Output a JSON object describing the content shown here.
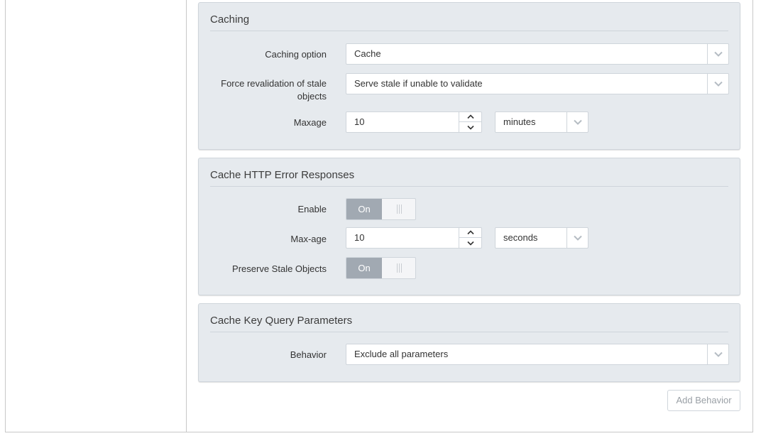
{
  "caching": {
    "title": "Caching",
    "option_label": "Caching option",
    "option_value": "Cache",
    "revalidation_label": "Force revalidation of stale objects",
    "revalidation_value": "Serve stale if unable to validate",
    "maxage_label": "Maxage",
    "maxage_value": "10",
    "maxage_unit": "minutes"
  },
  "error_responses": {
    "title": "Cache HTTP Error Responses",
    "enable_label": "Enable",
    "enable_state": "On",
    "maxage_label": "Max-age",
    "maxage_value": "10",
    "maxage_unit": "seconds",
    "preserve_label": "Preserve Stale Objects",
    "preserve_state": "On"
  },
  "cache_key": {
    "title": "Cache Key Query Parameters",
    "behavior_label": "Behavior",
    "behavior_value": "Exclude all parameters"
  },
  "actions": {
    "add_behavior_label": "Add Behavior"
  },
  "colors": {
    "panel_bg": "#e6eaee",
    "toggle_on": "#a1a9b2",
    "caret": "#b5bcc3"
  },
  "icons": {
    "dropdown": "chevron-down-icon",
    "spin_up": "chevron-up-icon",
    "spin_down": "chevron-down-icon",
    "toggle_grip": "grip-icon"
  }
}
